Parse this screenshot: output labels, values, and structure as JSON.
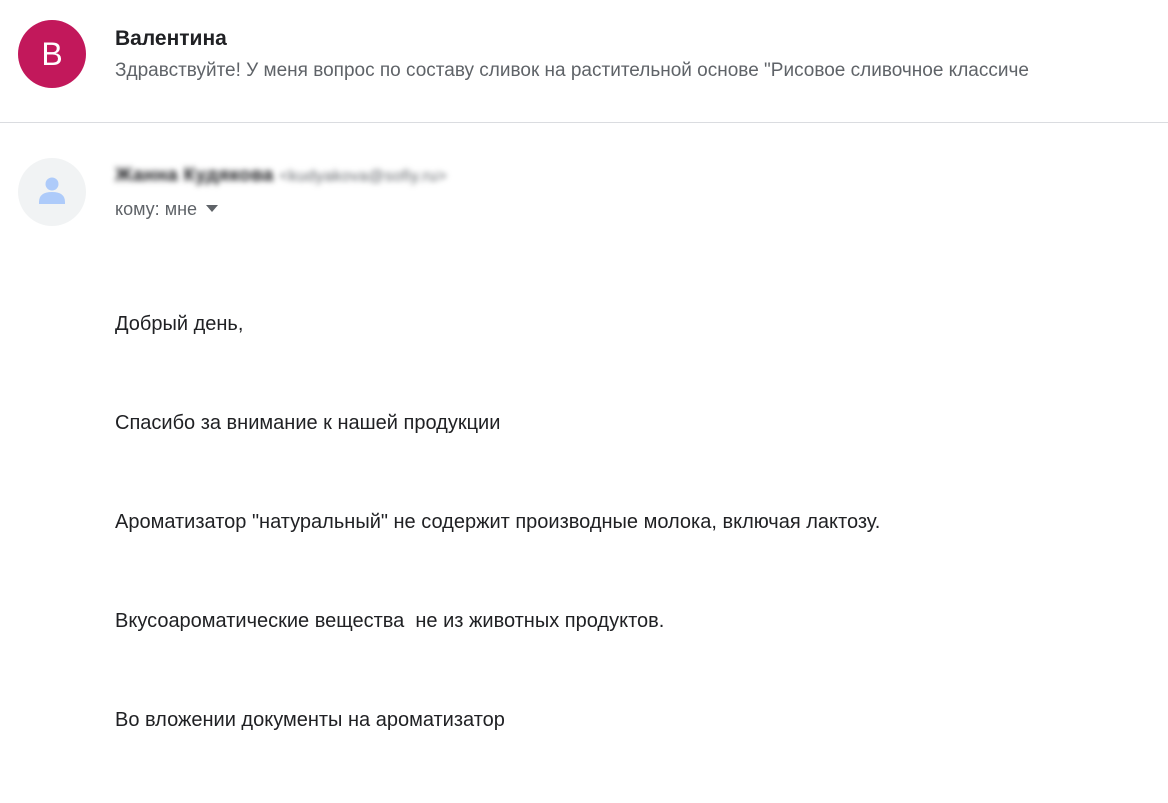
{
  "thread": {
    "avatar_letter": "В",
    "sender_name": "Валентина",
    "snippet": "Здравствуйте! У меня вопрос по составу сливок на растительной основе \"Рисовое сливочное классиче"
  },
  "message": {
    "sender_name": "Жанна Кудякова",
    "sender_email": "<kudyakova@sofiy.ru>",
    "recipient_label": "кому:",
    "recipient_value": "мне",
    "body": [
      "Добрый день,",
      "Спасибо за внимание к нашей продукции",
      "Ароматизатор \"натуральный\" не содержит производные молока, включая лактозу.",
      "Вкусоароматические вещества  не из животных продуктов.",
      "Во вложении документы на ароматизатор"
    ]
  },
  "colors": {
    "avatar_bg": "#c2185b",
    "default_avatar_bg": "#f1f3f4",
    "default_avatar_fg": "#aecbfa"
  },
  "icons": {
    "person": "person-icon",
    "dropdown": "arrow-drop-down-icon"
  }
}
